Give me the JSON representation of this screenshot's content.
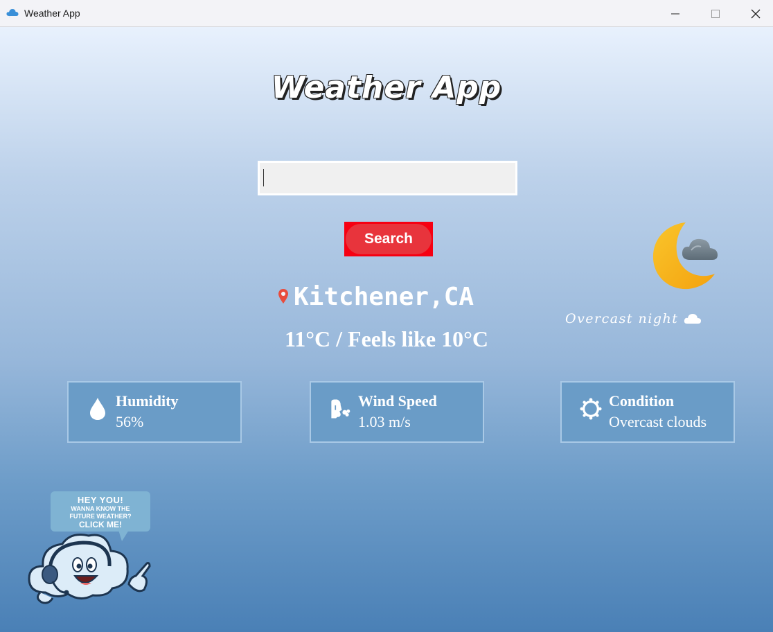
{
  "window": {
    "title": "Weather App"
  },
  "app": {
    "heading": "Weather App"
  },
  "search": {
    "value": "",
    "button_label": "Search"
  },
  "location": {
    "text": "Kitchener,CA"
  },
  "temperature": {
    "text": "11°C / Feels like 10°C"
  },
  "current": {
    "caption": "Overcast night"
  },
  "cards": {
    "humidity": {
      "label": "Humidity",
      "value": "56%"
    },
    "wind": {
      "label": "Wind Speed",
      "value": "1.03 m/s"
    },
    "condition": {
      "label": "Condition",
      "value": "Overcast clouds"
    }
  },
  "mascot": {
    "line1": "HEY YOU!",
    "line2": "WANNA KNOW THE",
    "line3": "FUTURE WEATHER?",
    "line4": "CLICK ME!"
  },
  "colors": {
    "search_button": "#f60012",
    "search_pill": "#e8343c",
    "card_bg": "#6a9cc7",
    "moon": "#f7b519",
    "pin": "#e84c3d"
  },
  "icons": {
    "app": "cloud-icon",
    "location": "map-pin-icon",
    "weather": "moon-cloud-icon",
    "humidity": "water-drop-icon",
    "wind": "wind-face-icon",
    "condition": "sun-ring-icon"
  }
}
